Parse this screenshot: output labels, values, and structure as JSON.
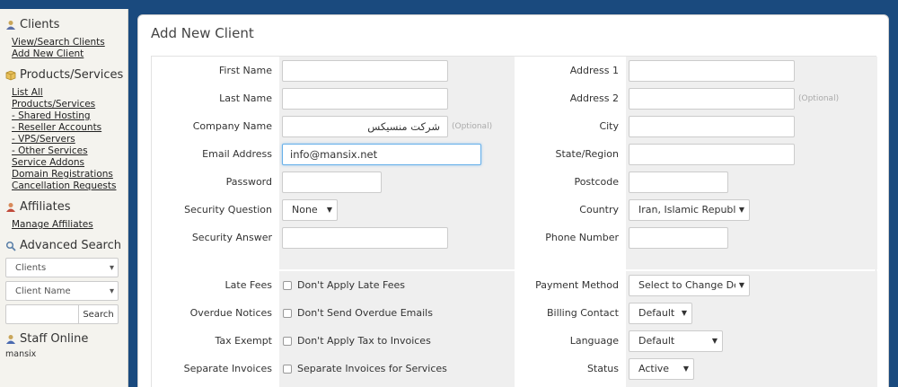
{
  "sidebar": {
    "clients": {
      "title": "Clients",
      "links": [
        "View/Search Clients",
        "Add New Client"
      ]
    },
    "products": {
      "title": "Products/Services",
      "links": [
        "List All Products/Services",
        "- Shared Hosting",
        "- Reseller Accounts",
        "- VPS/Servers",
        "- Other Services",
        "Service Addons",
        "Domain Registrations",
        "Cancellation Requests"
      ]
    },
    "affiliates": {
      "title": "Affiliates",
      "links": [
        "Manage Affiliates"
      ]
    },
    "advanced_search": {
      "title": "Advanced Search",
      "type_select": "Clients",
      "field_select": "Client Name",
      "search_button": "Search"
    },
    "staff_online": {
      "title": "Staff Online",
      "name": "mansix"
    }
  },
  "main": {
    "title": "Add New Client",
    "optional_label": "(Optional)",
    "left": {
      "first_name": {
        "label": "First Name",
        "value": ""
      },
      "last_name": {
        "label": "Last Name",
        "value": ""
      },
      "company_name": {
        "label": "Company Name",
        "value": "شرکت منسیکس"
      },
      "email": {
        "label": "Email Address",
        "value": "info@mansix.net"
      },
      "password": {
        "label": "Password",
        "value": ""
      },
      "security_question": {
        "label": "Security Question",
        "value": "None"
      },
      "security_answer": {
        "label": "Security Answer",
        "value": ""
      },
      "late_fees": {
        "label": "Late Fees",
        "checkbox": "Don't Apply Late Fees"
      },
      "overdue_notices": {
        "label": "Overdue Notices",
        "checkbox": "Don't Send Overdue Emails"
      },
      "tax_exempt": {
        "label": "Tax Exempt",
        "checkbox": "Don't Apply Tax to Invoices"
      },
      "separate_invoices": {
        "label": "Separate Invoices",
        "checkbox": "Separate Invoices for Services"
      }
    },
    "right": {
      "address1": {
        "label": "Address 1",
        "value": ""
      },
      "address2": {
        "label": "Address 2",
        "value": ""
      },
      "city": {
        "label": "City",
        "value": ""
      },
      "state": {
        "label": "State/Region",
        "value": ""
      },
      "postcode": {
        "label": "Postcode",
        "value": ""
      },
      "country": {
        "label": "Country",
        "value": "Iran, Islamic Republic"
      },
      "phone": {
        "label": "Phone Number",
        "value": ""
      },
      "payment_method": {
        "label": "Payment Method",
        "value": "Select to Change Def"
      },
      "billing_contact": {
        "label": "Billing Contact",
        "value": "Default"
      },
      "language": {
        "label": "Language",
        "value": "Default"
      },
      "status": {
        "label": "Status",
        "value": "Active"
      }
    }
  }
}
